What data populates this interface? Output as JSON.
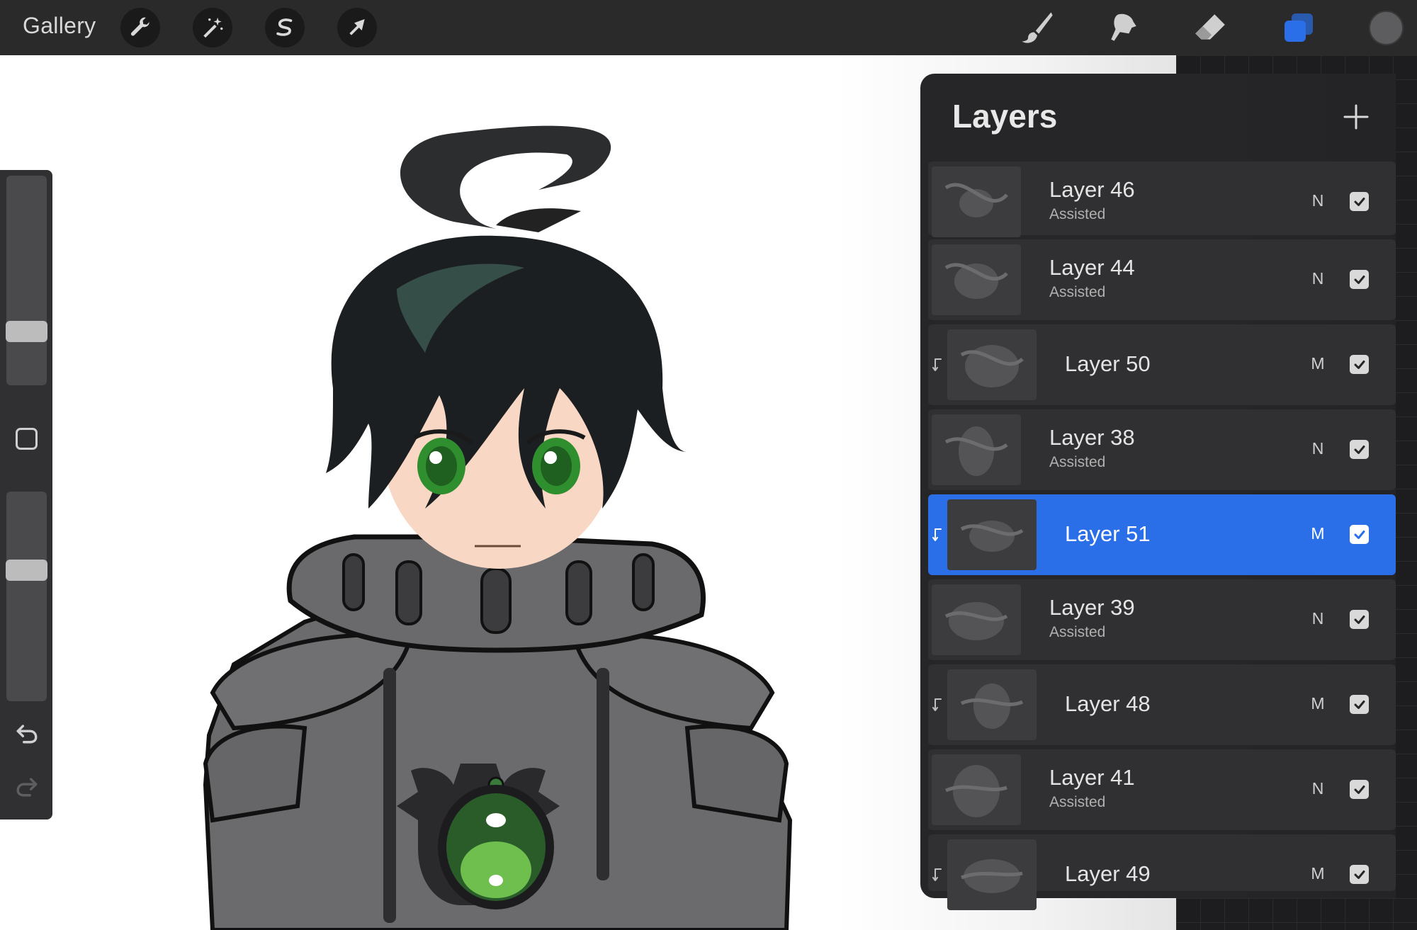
{
  "topbar": {
    "gallery_label": "Gallery",
    "left_tools": [
      {
        "name": "actions",
        "icon": "wrench-icon"
      },
      {
        "name": "adjustments",
        "icon": "magic-wand-icon"
      },
      {
        "name": "selection",
        "icon": "selection-s-icon"
      },
      {
        "name": "transform",
        "icon": "arrow-cursor-icon"
      }
    ],
    "right_tools": [
      {
        "name": "brush",
        "icon": "brush-icon"
      },
      {
        "name": "smudge",
        "icon": "smudge-icon"
      },
      {
        "name": "eraser",
        "icon": "eraser-icon"
      },
      {
        "name": "layers",
        "icon": "layers-icon",
        "active": true
      }
    ],
    "color_swatch": "#5d5d5f"
  },
  "sidebar": {
    "brush_size_level": 0.72,
    "opacity_level": 0.4,
    "modify_icon": "square-icon",
    "undo_icon": "undo-icon",
    "redo_icon": "redo-icon"
  },
  "layers": {
    "title": "Layers",
    "add_icon": "plus-icon",
    "accent": "#2a6fe7",
    "items": [
      {
        "name": "Layer 46",
        "sub": "Assisted",
        "blend": "N",
        "checked": true,
        "clipped": false,
        "selected": false
      },
      {
        "name": "Layer 44",
        "sub": "Assisted",
        "blend": "N",
        "checked": true,
        "clipped": false,
        "selected": false
      },
      {
        "name": "Layer 50",
        "sub": "",
        "blend": "M",
        "checked": true,
        "clipped": true,
        "selected": false
      },
      {
        "name": "Layer 38",
        "sub": "Assisted",
        "blend": "N",
        "checked": true,
        "clipped": false,
        "selected": false
      },
      {
        "name": "Layer 51",
        "sub": "",
        "blend": "M",
        "checked": true,
        "clipped": true,
        "selected": true
      },
      {
        "name": "Layer 39",
        "sub": "Assisted",
        "blend": "N",
        "checked": true,
        "clipped": false,
        "selected": false
      },
      {
        "name": "Layer 48",
        "sub": "",
        "blend": "M",
        "checked": true,
        "clipped": true,
        "selected": false
      },
      {
        "name": "Layer 41",
        "sub": "Assisted",
        "blend": "N",
        "checked": true,
        "clipped": false,
        "selected": false
      },
      {
        "name": "Layer 49",
        "sub": "",
        "blend": "M",
        "checked": true,
        "clipped": true,
        "selected": false
      }
    ]
  }
}
